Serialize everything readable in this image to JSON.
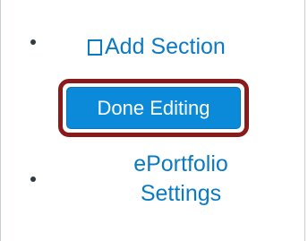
{
  "menu": {
    "add_section_label": "Add Section",
    "add_section_icon": "square-box-icon",
    "done_editing_label": "Done Editing",
    "eportfolio_settings_line1": "ePortfolio",
    "eportfolio_settings_line2": "Settings"
  },
  "colors": {
    "link": "#0b7ac5",
    "button_bg": "#0b8ad9",
    "highlight_border": "#8b1a1a",
    "bullet": "#2d3b45"
  }
}
